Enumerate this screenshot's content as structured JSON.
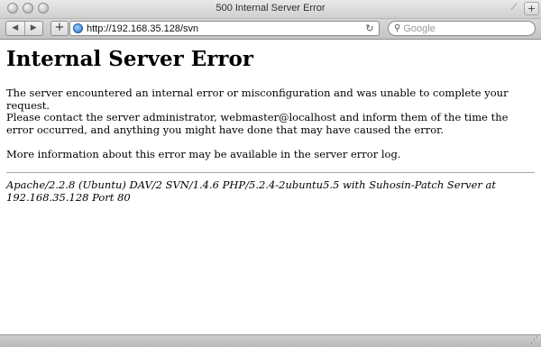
{
  "window": {
    "title": "500 Internal Server Error",
    "new_tab_label": "+"
  },
  "toolbar": {
    "back_label": "◀",
    "forward_label": "▶",
    "add_bookmark_label": "+",
    "url": "http://192.168.35.128/svn",
    "reload_label": "↻",
    "search_placeholder": "Google"
  },
  "page": {
    "heading": "Internal Server Error",
    "paragraph1": "The server encountered an internal error or misconfiguration and was unable to complete your request.",
    "paragraph2": "Please contact the server administrator, webmaster@localhost and inform them of the time the error occurred, and anything you might have done that may have caused the error.",
    "paragraph3": "More information about this error may be available in the server error log.",
    "server_signature": "Apache/2.2.8 (Ubuntu) DAV/2 SVN/1.4.6 PHP/5.2.4-2ubuntu5.5 with Suhosin-Patch Server at 192.168.35.128 Port 80"
  }
}
